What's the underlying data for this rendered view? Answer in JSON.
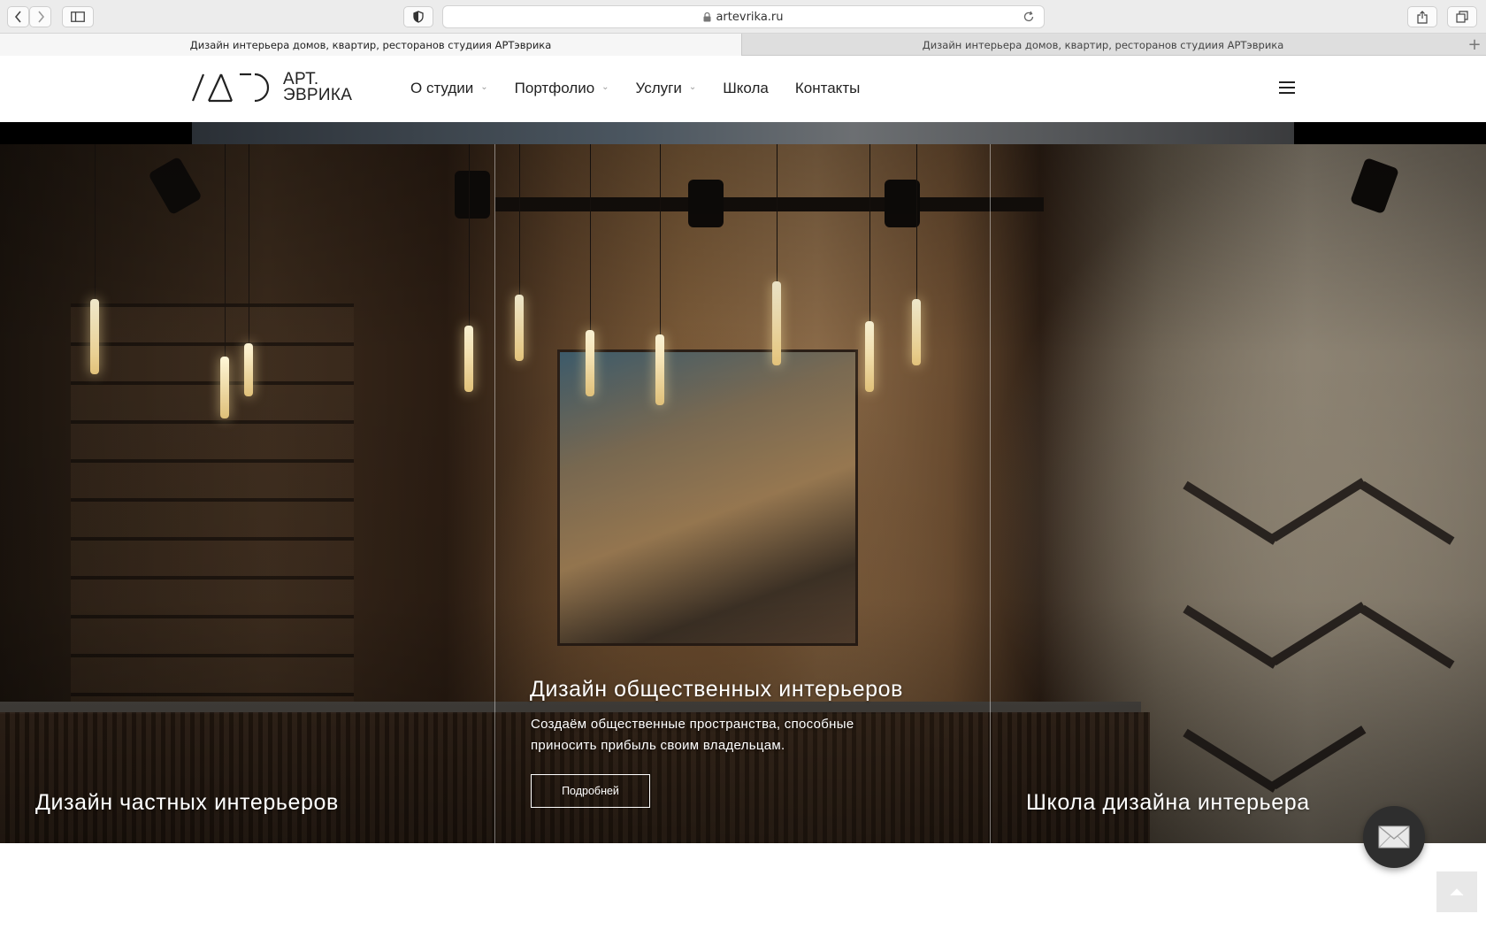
{
  "browser": {
    "url": "artevrika.ru",
    "tabs": [
      {
        "title": "Дизайн интерьера домов, квартир, ресторанов студиия АРТэврика"
      },
      {
        "title": "Дизайн интерьера домов, квартир, ресторанов студиия АРТэврика"
      }
    ],
    "icons": [
      "back-icon",
      "forward-icon",
      "sidebar-icon",
      "shield-icon",
      "lock-icon",
      "reload-icon",
      "share-icon",
      "tabs-overview-icon",
      "new-tab-icon"
    ]
  },
  "site": {
    "logo": {
      "line1": "АРТ.",
      "line2": "ЭВРИКА"
    },
    "nav": [
      {
        "label": "О студии",
        "has_dropdown": true
      },
      {
        "label": "Портфолио",
        "has_dropdown": true
      },
      {
        "label": "Услуги",
        "has_dropdown": true
      },
      {
        "label": "Школа",
        "has_dropdown": false
      },
      {
        "label": "Контакты",
        "has_dropdown": false
      }
    ]
  },
  "hero": {
    "panels": [
      {
        "title": "Дизайн частных интерьеров"
      },
      {
        "title": "Дизайн общественных интерьеров",
        "description": "Создаём общественные пространства, способные приносить прибыль своим владельцам.",
        "button": "Подробней"
      },
      {
        "title": "Школа дизайна интерьера"
      }
    ]
  },
  "colors": {
    "text": "#222222",
    "hero_text": "#ffffff",
    "fab": "#2e2e2e"
  }
}
